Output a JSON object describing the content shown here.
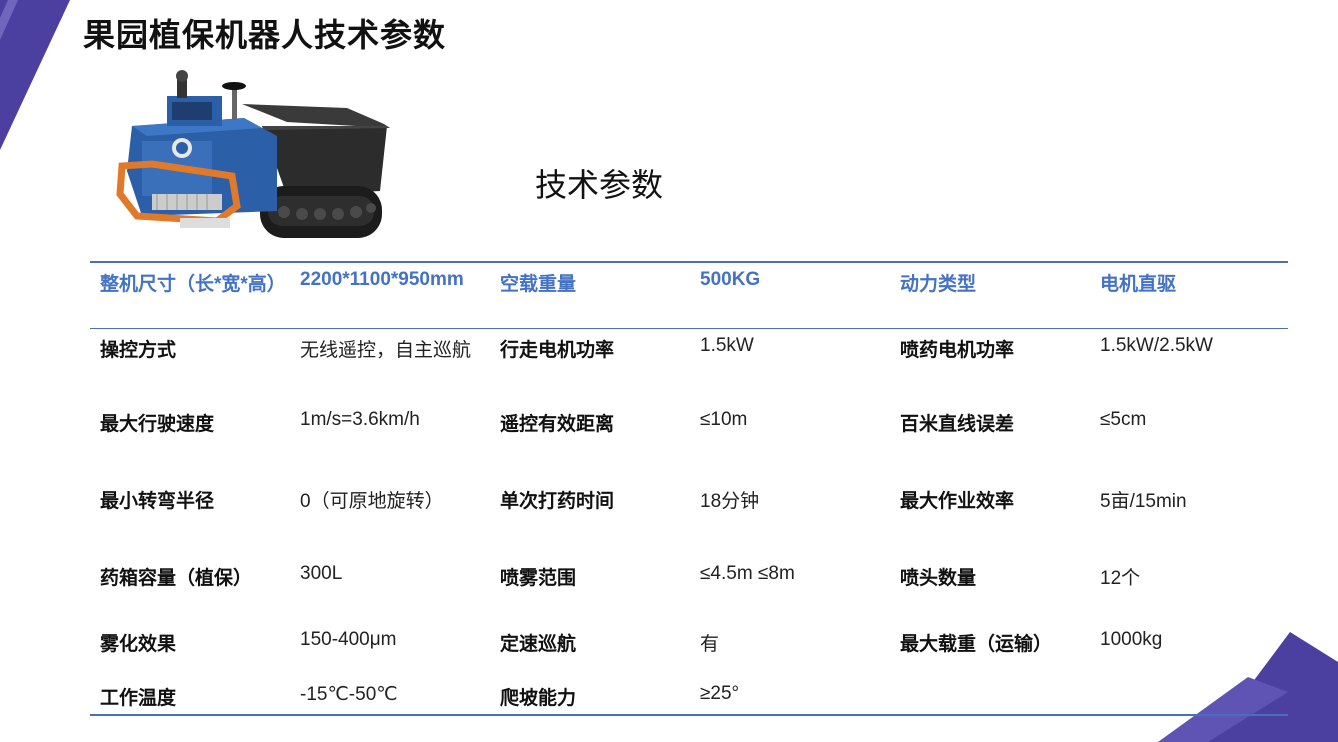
{
  "title": "果园植保机器人技术参数",
  "subtitle": "技术参数",
  "colors": {
    "accent": "#4472c4",
    "decor": "#4b3fa0",
    "rule": "#4a6fb8"
  },
  "table": {
    "header": [
      {
        "label": "整机尺寸（长*宽*高）",
        "value": "2200*1100*950mm"
      },
      {
        "label": "空载重量",
        "value": "500KG"
      },
      {
        "label": "动力类型",
        "value": "电机直驱"
      }
    ],
    "rows": [
      [
        {
          "label": "操控方式",
          "value": "无线遥控，自主巡航"
        },
        {
          "label": "行走电机功率",
          "value": "1.5kW"
        },
        {
          "label": "喷药电机功率",
          "value": "1.5kW/2.5kW"
        }
      ],
      [
        {
          "label": "最大行驶速度",
          "value": "1m/s=3.6km/h"
        },
        {
          "label": "遥控有效距离",
          "value": "≤10m"
        },
        {
          "label": "百米直线误差",
          "value": "≤5cm"
        }
      ],
      [
        {
          "label": "最小转弯半径",
          "value": "0（可原地旋转）"
        },
        {
          "label": "单次打药时间",
          "value": "18分钟"
        },
        {
          "label": "最大作业效率",
          "value": "5亩/15min"
        }
      ],
      [
        {
          "label": "药箱容量（植保）",
          "value": "300L"
        },
        {
          "label": "喷雾范围",
          "value": "≤4.5m ≤8m"
        },
        {
          "label": "喷头数量",
          "value": "12个"
        }
      ],
      [
        {
          "label": "雾化效果",
          "value": "150-400μm"
        },
        {
          "label": "定速巡航",
          "value": "有"
        },
        {
          "label": "最大载重（运输）",
          "value": "1000kg"
        }
      ],
      [
        {
          "label": "工作温度",
          "value": "-15℃-50℃"
        },
        {
          "label": "爬坡能力",
          "value": "≥25°"
        },
        {
          "label": "",
          "value": ""
        }
      ]
    ]
  }
}
